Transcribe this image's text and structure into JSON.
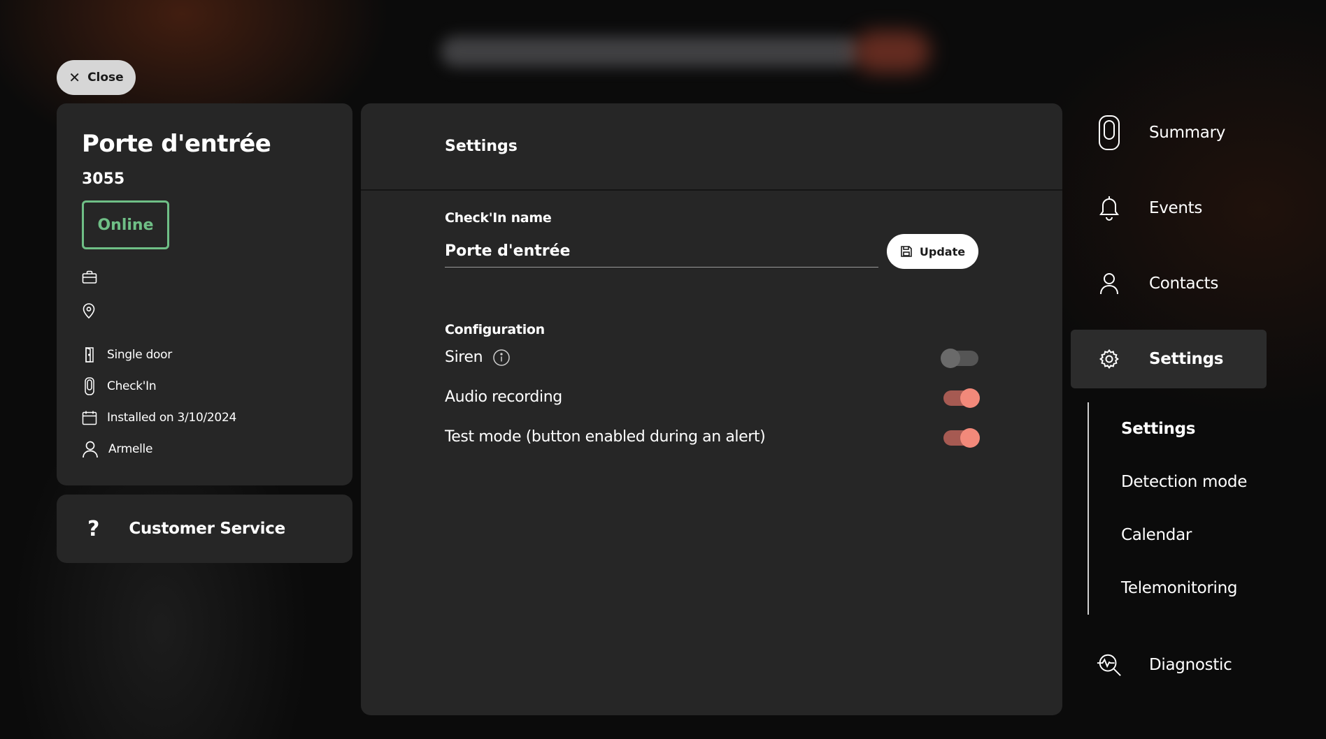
{
  "close_label": "Close",
  "device": {
    "name": "Porte d'entrée",
    "id": "3055",
    "status": "Online",
    "details": [
      {
        "icon": "door-icon",
        "label": "Single door"
      },
      {
        "icon": "device-icon",
        "label": "Check'In"
      },
      {
        "icon": "calendar-icon",
        "label": "Installed on 3/10/2024"
      },
      {
        "icon": "user-icon",
        "label": "Armelle"
      }
    ]
  },
  "customer_service": {
    "icon": "?",
    "label": "Customer Service"
  },
  "settings_panel": {
    "title": "Settings",
    "name_label": "Check'In name",
    "name_value": "Porte d'entrée",
    "update_label": "Update",
    "config_label": "Configuration",
    "options": [
      {
        "label": "Siren",
        "info": true,
        "enabled": false
      },
      {
        "label": "Audio recording",
        "info": false,
        "enabled": true
      },
      {
        "label": "Test mode (button enabled during an alert)",
        "info": false,
        "enabled": true
      }
    ]
  },
  "nav": {
    "summary": "Summary",
    "events": "Events",
    "contacts": "Contacts",
    "settings": "Settings",
    "sub": [
      "Settings",
      "Detection mode",
      "Calendar",
      "Telemonitoring"
    ],
    "diagnostic": "Diagnostic"
  },
  "colors": {
    "online": "#6fbf86",
    "accent": "#f2897a",
    "card": "#262626"
  }
}
